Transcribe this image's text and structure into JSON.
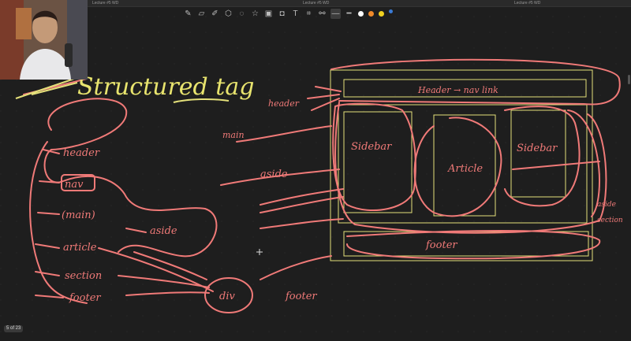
{
  "window": {
    "tab_left": "Lecture #5 WD",
    "tab_center": "Lecture #5 WD",
    "tab_right": "Lecture #5 WD"
  },
  "toolbar": {
    "tools": [
      "pen-icon",
      "eraser-icon",
      "highlighter-icon",
      "shapes-icon",
      "lasso-icon",
      "sticker-icon",
      "image-icon",
      "camera-icon",
      "textbox-icon",
      "scan-icon",
      "link-icon"
    ],
    "colors": [
      "#ffffff",
      "#f08a2a",
      "#f0d020",
      "#3a7bd5"
    ]
  },
  "board": {
    "heading": "Structured tag",
    "left_list": [
      "header",
      "nav",
      "(main)",
      "article",
      "section",
      "footer"
    ],
    "aside_label": "aside",
    "div_label": "div",
    "main_label": "main",
    "header_arrow_label": "header",
    "aside_arrow_label": "aside",
    "footer_arrow_label": "footer",
    "wireframe_header": "Header → nav link",
    "wireframe_sidebar_left": "Sidebar",
    "wireframe_article": "Article",
    "wireframe_sidebar_right": "Sidebar",
    "wireframe_footer": "footer",
    "right_note_1": "aside",
    "right_note_2": "section"
  },
  "status": {
    "page_indicator": "5 of 23"
  }
}
